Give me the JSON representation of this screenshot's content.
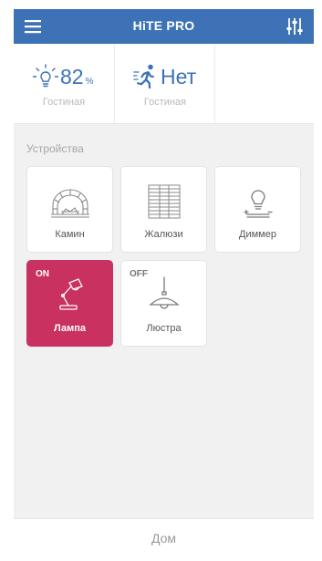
{
  "app": {
    "title": "HiTE PRO",
    "accent": "#3d73b6",
    "active_color": "#c83160"
  },
  "header": {
    "menu_icon": "menu-icon",
    "settings_icon": "sliders-icon"
  },
  "sensors": [
    {
      "icon": "bulb-icon",
      "value": "82",
      "unit": "%",
      "room": "Гостиная"
    },
    {
      "icon": "motion-icon",
      "value": "Нет",
      "room": "Гостиная"
    }
  ],
  "devices": {
    "section_title": "Устройства",
    "items": [
      {
        "label": "Камин",
        "icon": "fireplace-icon",
        "state": ""
      },
      {
        "label": "Жалюзи",
        "icon": "blinds-icon",
        "state": ""
      },
      {
        "label": "Диммер",
        "icon": "dimmer-icon",
        "state": ""
      },
      {
        "label": "Лампа",
        "icon": "desk-lamp-icon",
        "state": "ON"
      },
      {
        "label": "Люстра",
        "icon": "chandelier-icon",
        "state": "OFF"
      }
    ]
  },
  "bottom": {
    "label": "Дом"
  }
}
